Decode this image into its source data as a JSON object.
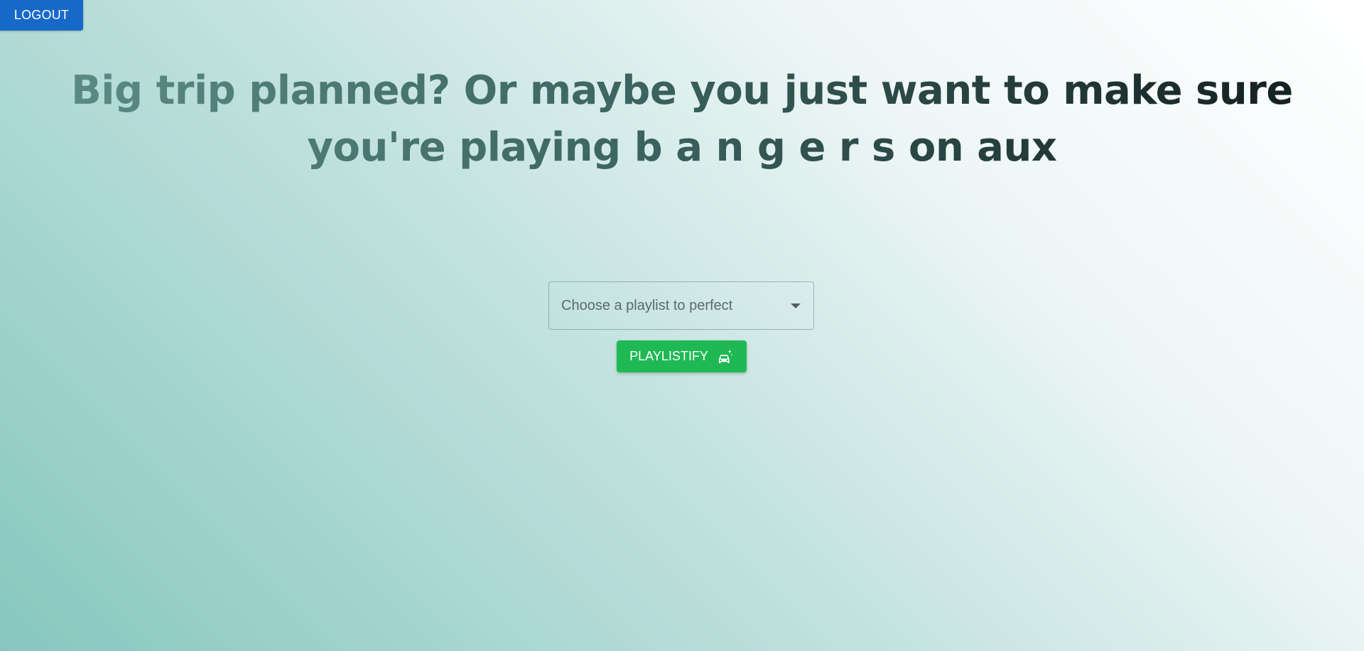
{
  "header": {
    "logout_label": "LOGOUT"
  },
  "hero": {
    "headline_line1": "Big trip planned? Or maybe you just want to make sure",
    "headline_line2": "you're playing b a n g e r s on aux"
  },
  "playlist_select": {
    "placeholder": "Choose a playlist to perfect",
    "icon": "chevron-down-icon"
  },
  "action": {
    "playlistify_label": "PLAYLISTIFY",
    "icon": "car-icon"
  },
  "colors": {
    "logout_button": "#1769c9",
    "playlistify_button": "#1fb954",
    "background_start": "#86c7bf",
    "background_end": "#ffffff"
  }
}
